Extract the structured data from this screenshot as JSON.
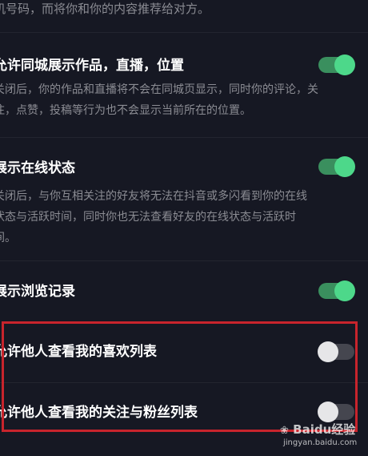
{
  "settings": {
    "top_desc": "机号码，而将你和你的内容推荐给对方。",
    "items": [
      {
        "title": "允许同城展示作品，直播，位置",
        "desc_lines": [
          "关闭后，你的作品和直播将不会在同城页显示，同时你的评论，关",
          "注，点赞，投稿等行为也不会显示当前所在的位置。"
        ],
        "enabled": true
      },
      {
        "title": "展示在线状态",
        "desc_lines": [
          "关闭后，与你互相关注的好友将无法在抖音或多闪看到你的在线",
          "状态与活跃时间，同时你也无法查看好友的在线状态与活跃时",
          "间。"
        ],
        "enabled": true
      },
      {
        "title": "展示浏览记录",
        "desc_lines": [],
        "enabled": true
      },
      {
        "title": "允许他人查看我的喜欢列表",
        "desc_lines": [],
        "enabled": false
      },
      {
        "title": "允许他人查看我的关注与粉丝列表",
        "desc_lines": [],
        "enabled": false
      }
    ]
  },
  "watermark": {
    "logo": "Baidu经验",
    "url": "jingyan.baidu.com"
  },
  "colors": {
    "background": "#161823",
    "toggle_on": "#4dd88a",
    "toggle_off": "#45464f",
    "highlight": "#c8242c"
  }
}
